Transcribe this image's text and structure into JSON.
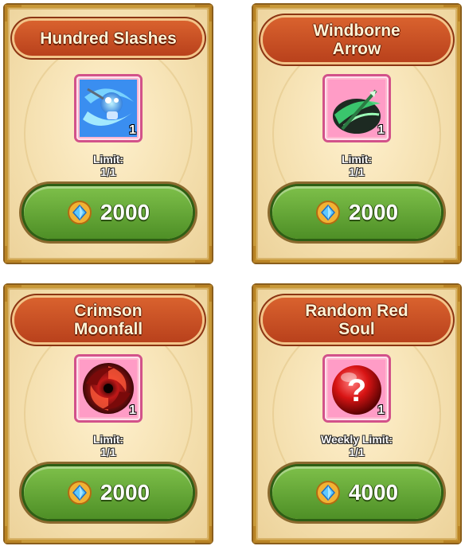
{
  "cards": [
    {
      "title": "Hundred Slashes",
      "quantity": "1",
      "limit_label": "Limit:",
      "limit_value": "1/1",
      "price": "2000",
      "icon": "hundred-slashes-icon"
    },
    {
      "title": "Windborne Arrow",
      "quantity": "1",
      "limit_label": "Limit:",
      "limit_value": "1/1",
      "price": "2000",
      "icon": "windborne-arrow-icon"
    },
    {
      "title": "Crimson Moonfall",
      "quantity": "1",
      "limit_label": "Limit:",
      "limit_value": "1/1",
      "price": "2000",
      "icon": "crimson-moonfall-icon"
    },
    {
      "title": "Random Red Soul",
      "quantity": "1",
      "limit_label": "Weekly Limit:",
      "limit_value": "1/1",
      "price": "4000",
      "icon": "random-red-soul-icon"
    }
  ],
  "currency_icon": "blue-gem-icon",
  "colors": {
    "button_green": "#5fa032",
    "banner_red": "#c74a22",
    "card_bg": "#f4dfae",
    "item_frame": "#ffb6cf"
  }
}
